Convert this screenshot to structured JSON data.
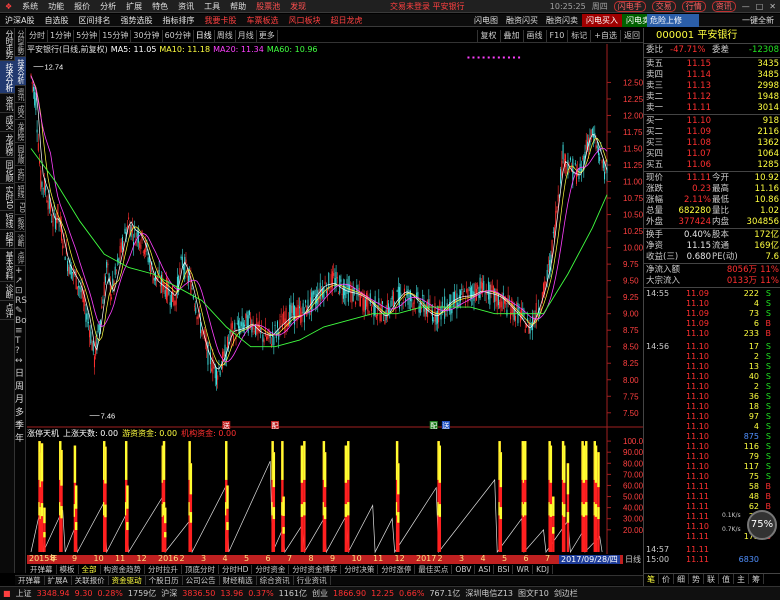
{
  "menu": {
    "items": [
      "系统",
      "功能",
      "报价",
      "分析",
      "扩展",
      "特色",
      "资讯",
      "工具",
      "帮助"
    ],
    "highlight": "股票池",
    "message": "交易未登录  平安银行",
    "clock": "10:25:25",
    "weekday": "周四",
    "buttons": [
      "闪电手",
      "交易",
      "行情",
      "资讯"
    ]
  },
  "funcbar": {
    "left": [
      "沪深A股",
      "自选股",
      "区间排名",
      "强势选股",
      "指标排序"
    ],
    "left_red": [
      "我要卡股",
      "车票板选",
      "风口板块",
      "超日龙虎"
    ],
    "right": [
      "闪电图",
      "融资闪买",
      "融资闪卖",
      "闪电买入",
      "闪电卖出"
    ],
    "ad": "危险上修",
    "help": "一键全新"
  },
  "leftbar": {
    "tabs": [
      "分时走势",
      "技术分析",
      "资讯",
      "成交",
      "龙虎榜",
      "同花顺",
      "实时10",
      "短线",
      "超市",
      "基本资料",
      "诊断",
      "点评"
    ],
    "active_index": 1,
    "tools": [
      "+",
      "↗",
      "⊡",
      "RSI",
      "✎",
      "Bot",
      "≡",
      "T",
      "?",
      "↔"
    ],
    "vertical_labels": [
      "日",
      "周",
      "月",
      "多",
      "季",
      "年"
    ]
  },
  "leftbar2": {
    "tabs": [
      "分时走势",
      "技术分析",
      "资讯",
      "成交",
      "龙虎榜",
      "同花顺",
      "实时",
      "短线",
      "F10",
      "板块",
      "诊断",
      "点评"
    ]
  },
  "period_bar": {
    "items": [
      "分时",
      "1分钟",
      "5分钟",
      "15分钟",
      "30分钟",
      "60分钟",
      "日线",
      "周线",
      "月线",
      "更多"
    ],
    "active": "日线",
    "right": [
      "复权",
      "叠加",
      "画线",
      "F10",
      "标记",
      "+自选",
      "返回"
    ]
  },
  "chart": {
    "title": "平安银行(日线,前复权)",
    "ma": [
      {
        "label": "MA5: 11.05",
        "color": "#ffffff"
      },
      {
        "label": "MA10: 11.18",
        "color": "#ffff40"
      },
      {
        "label": "MA20: 11.34",
        "color": "#ff40ff"
      },
      {
        "label": "MA60: 10.96",
        "color": "#40ff40"
      }
    ],
    "high_label": "12.74",
    "low_label": "7.46",
    "yticks": [
      "12.50",
      "12.25",
      "12.00",
      "11.75",
      "11.50",
      "11.25",
      "11.00",
      "10.75",
      "10.50",
      "10.25",
      "10.00",
      "9.75",
      "9.50",
      "9.25",
      "9.00",
      "8.75",
      "8.50",
      "8.25",
      "8.00",
      "7.75",
      "7.50"
    ],
    "ind_yticks": [
      "100.00",
      "90.00",
      "80.00",
      "70.00",
      "60.00",
      "50.00",
      "40.00",
      "30.00",
      "20.00"
    ],
    "indicator": [
      {
        "label": "涨停天机",
        "color": "#ffffff"
      },
      {
        "label": "上涨天数: 0.00",
        "color": "#ffffff"
      },
      {
        "label": "游资资金: 0.00",
        "color": "#ffff40"
      },
      {
        "label": "机构资金: 0.00",
        "color": "#ff3030"
      }
    ],
    "event_markers": [
      "送",
      "配",
      "配",
      "送"
    ],
    "candle_colors": {
      "up": "#ff3030",
      "down": "#40e0e0",
      "ma5": "#ffffff",
      "ma10": "#ffff40",
      "ma20": "#ff40ff",
      "ma60": "#40ff40"
    }
  },
  "chart_data": {
    "type": "candlestick",
    "title": "平安银行(日线,前复权)",
    "ylim": [
      7.3,
      12.9
    ],
    "ind_ylim": [
      0,
      110
    ],
    "x_labels": [
      "2015年",
      "8",
      "9",
      "10",
      "11",
      "12",
      "2016",
      "2",
      "3",
      "4",
      "5",
      "6",
      "7",
      "8",
      "9",
      "10",
      "11",
      "12",
      "2017",
      "2",
      "3",
      "4",
      "5",
      "6",
      "7"
    ],
    "current_date": "2017/09/28/四",
    "price_path": [
      [
        0,
        12.6
      ],
      [
        4,
        12.2
      ],
      [
        8,
        11.0
      ],
      [
        12,
        10.9
      ],
      [
        18,
        10.4
      ],
      [
        22,
        10.5
      ],
      [
        30,
        9.8
      ],
      [
        40,
        9.4
      ],
      [
        48,
        8.8
      ],
      [
        52,
        8.3
      ],
      [
        58,
        9.1
      ],
      [
        62,
        9.7
      ],
      [
        66,
        9.3
      ],
      [
        72,
        9.8
      ],
      [
        80,
        10.4
      ],
      [
        84,
        10.2
      ],
      [
        88,
        10.2
      ],
      [
        94,
        10.0
      ],
      [
        100,
        9.6
      ],
      [
        110,
        9.4
      ],
      [
        118,
        9.2
      ],
      [
        124,
        9.8
      ],
      [
        132,
        9.4
      ],
      [
        138,
        8.9
      ],
      [
        145,
        8.4
      ],
      [
        152,
        8.1
      ],
      [
        158,
        8.3
      ],
      [
        164,
        8.7
      ],
      [
        172,
        8.8
      ],
      [
        180,
        8.9
      ],
      [
        188,
        8.7
      ],
      [
        196,
        8.6
      ],
      [
        204,
        8.8
      ],
      [
        212,
        9.0
      ],
      [
        222,
        9.0
      ],
      [
        232,
        9.2
      ],
      [
        240,
        9.4
      ],
      [
        248,
        9.5
      ],
      [
        256,
        9.4
      ],
      [
        264,
        9.3
      ],
      [
        272,
        9.2
      ],
      [
        282,
        9.1
      ],
      [
        290,
        9.0
      ],
      [
        298,
        9.2
      ],
      [
        306,
        9.3
      ],
      [
        314,
        9.2
      ],
      [
        322,
        9.1
      ],
      [
        332,
        9.0
      ],
      [
        340,
        9.1
      ],
      [
        350,
        9.2
      ],
      [
        360,
        9.3
      ],
      [
        368,
        9.4
      ],
      [
        376,
        9.3
      ],
      [
        384,
        9.2
      ],
      [
        392,
        9.1
      ],
      [
        400,
        9.0
      ],
      [
        408,
        8.8
      ],
      [
        414,
        9.0
      ],
      [
        420,
        9.3
      ],
      [
        426,
        9.8
      ],
      [
        432,
        10.8
      ],
      [
        436,
        11.4
      ],
      [
        442,
        11.2
      ],
      [
        450,
        11.1
      ],
      [
        456,
        11.6
      ],
      [
        460,
        11.7
      ],
      [
        466,
        11.4
      ],
      [
        472,
        11.1
      ]
    ],
    "ma60_path": [
      [
        0,
        11.5
      ],
      [
        20,
        11.0
      ],
      [
        40,
        10.4
      ],
      [
        60,
        9.9
      ],
      [
        80,
        9.7
      ],
      [
        100,
        9.6
      ],
      [
        120,
        9.4
      ],
      [
        140,
        9.2
      ],
      [
        160,
        8.8
      ],
      [
        180,
        8.5
      ],
      [
        200,
        8.5
      ],
      [
        220,
        8.6
      ],
      [
        240,
        8.8
      ],
      [
        260,
        8.9
      ],
      [
        280,
        9.0
      ],
      [
        300,
        9.0
      ],
      [
        320,
        9.1
      ],
      [
        340,
        9.1
      ],
      [
        360,
        9.1
      ],
      [
        380,
        9.0
      ],
      [
        400,
        9.0
      ],
      [
        420,
        9.0
      ],
      [
        440,
        9.6
      ],
      [
        460,
        10.3
      ],
      [
        472,
        10.8
      ]
    ],
    "sawtooth": [
      [
        0,
        0
      ],
      [
        8,
        40
      ],
      [
        10,
        0
      ],
      [
        26,
        38
      ],
      [
        28,
        0
      ],
      [
        36,
        22
      ],
      [
        38,
        0
      ],
      [
        60,
        45
      ],
      [
        62,
        0
      ],
      [
        78,
        34
      ],
      [
        80,
        0
      ],
      [
        108,
        50
      ],
      [
        110,
        0
      ],
      [
        130,
        28
      ],
      [
        132,
        0
      ],
      [
        160,
        60
      ],
      [
        162,
        0
      ],
      [
        196,
        82
      ],
      [
        198,
        0
      ],
      [
        206,
        20
      ],
      [
        208,
        0
      ],
      [
        222,
        24
      ],
      [
        224,
        0
      ],
      [
        240,
        30
      ],
      [
        242,
        0
      ],
      [
        258,
        32
      ],
      [
        260,
        0
      ],
      [
        280,
        42
      ],
      [
        282,
        0
      ],
      [
        296,
        30
      ],
      [
        298,
        0
      ],
      [
        332,
        58
      ],
      [
        334,
        0
      ],
      [
        380,
        65
      ],
      [
        382,
        0
      ],
      [
        402,
        30
      ],
      [
        404,
        0
      ],
      [
        420,
        20
      ],
      [
        422,
        0
      ],
      [
        440,
        28
      ],
      [
        442,
        0
      ],
      [
        452,
        18
      ],
      [
        454,
        0
      ],
      [
        466,
        14
      ],
      [
        468,
        0
      ]
    ],
    "spike_x": [
      7,
      8,
      9,
      11,
      24,
      25,
      36,
      37,
      60,
      61,
      78,
      79,
      108,
      109,
      110,
      130,
      131,
      160,
      161,
      198,
      199,
      206,
      207,
      222,
      224,
      240,
      241,
      258,
      260,
      300,
      301,
      334,
      335,
      384,
      385,
      403,
      404,
      405,
      425,
      426,
      428,
      436,
      437,
      440,
      452,
      453,
      455,
      462,
      463,
      465
    ],
    "spike_h": [
      100,
      90,
      98,
      40,
      100,
      92,
      96,
      60,
      100,
      95,
      100,
      60,
      96,
      100,
      40,
      100,
      80,
      100,
      60,
      100,
      90,
      100,
      50,
      96,
      100,
      100,
      90,
      96,
      100,
      100,
      80,
      100,
      96,
      100,
      90,
      100,
      96,
      100,
      100,
      96,
      50,
      100,
      96,
      80,
      100,
      96,
      100,
      100,
      96,
      90
    ]
  },
  "datebar": {
    "labels": [
      "2015年",
      "8",
      "9",
      "10",
      "11",
      "12",
      "2016",
      "2",
      "3",
      "4",
      "5",
      "6",
      "7",
      "8",
      "9",
      "10",
      "11",
      "12",
      "2017",
      "2",
      "3",
      "4",
      "5",
      "6",
      "7"
    ],
    "current": "2017/09/28/四",
    "right": "日线"
  },
  "tabs1": {
    "items": [
      "开弹幕",
      "模板",
      "全部",
      "构资金趋势",
      "分时拉升",
      "顶底分时",
      "分时HD",
      "分时资金",
      "分时资金博弈",
      "分时决策",
      "分时涨停",
      "最佳买点",
      "OBV",
      "ASI",
      "BSI",
      "WR",
      "KDJ"
    ],
    "active": "全部"
  },
  "tabs2": {
    "items": [
      "开弹幕",
      "扩展A",
      "关联报价",
      "资金驱动",
      "个股日历",
      "公司公告",
      "财经精选",
      "综合资讯",
      "行业资讯"
    ],
    "active": "资金驱动"
  },
  "status": {
    "items": [
      {
        "label": "上证",
        "color": "#ccc"
      },
      {
        "label": "3348.94",
        "color": "#ff3030"
      },
      {
        "label": "9.30",
        "color": "#ff3030"
      },
      {
        "label": "0.28%",
        "color": "#ff3030"
      },
      {
        "label": "1759亿",
        "color": "#ccc"
      },
      {
        "label": "沪深",
        "color": "#ccc"
      },
      {
        "label": "3836.50",
        "color": "#ff3030"
      },
      {
        "label": "13.96",
        "color": "#ff3030"
      },
      {
        "label": "0.37%",
        "color": "#ff3030"
      },
      {
        "label": "1161亿",
        "color": "#ccc"
      },
      {
        "label": "创业",
        "color": "#ccc"
      },
      {
        "label": "1866.90",
        "color": "#ff3030"
      },
      {
        "label": "12.25",
        "color": "#ff3030"
      },
      {
        "label": "0.66%",
        "color": "#ff3030"
      },
      {
        "label": "767.1亿",
        "color": "#ccc"
      },
      {
        "label": "深圳电信Z13",
        "color": "#ccc"
      },
      {
        "label": "图文F10",
        "color": "#ccc"
      },
      {
        "label": "剑边栏",
        "color": "#ccc"
      }
    ]
  },
  "panel": {
    "code_name": "000001 平安银行",
    "weibi": {
      "label": "委比",
      "value": "-47.71%",
      "label2": "委差",
      "value2": "-12308"
    },
    "asks": [
      {
        "label": "卖五",
        "price": "11.15",
        "vol": "3435"
      },
      {
        "label": "卖四",
        "price": "11.14",
        "vol": "3485"
      },
      {
        "label": "卖三",
        "price": "11.13",
        "vol": "2998"
      },
      {
        "label": "卖二",
        "price": "11.12",
        "vol": "1948"
      },
      {
        "label": "卖一",
        "price": "11.11",
        "vol": "3014"
      }
    ],
    "bids": [
      {
        "label": "买一",
        "price": "11.10",
        "vol": "918"
      },
      {
        "label": "买二",
        "price": "11.09",
        "vol": "2116"
      },
      {
        "label": "买三",
        "price": "11.08",
        "vol": "1362"
      },
      {
        "label": "买四",
        "price": "11.07",
        "vol": "1064"
      },
      {
        "label": "买五",
        "price": "11.06",
        "vol": "1285"
      }
    ],
    "stats": [
      {
        "l1": "现价",
        "v1": "11.11",
        "c1": "red",
        "l2": "今开",
        "v2": "10.92",
        "c2": "green"
      },
      {
        "l1": "涨跌",
        "v1": "0.23",
        "c1": "red",
        "l2": "最高",
        "v2": "11.16",
        "c2": "red"
      },
      {
        "l1": "涨幅",
        "v1": "2.11%",
        "c1": "red",
        "l2": "最低",
        "v2": "10.86",
        "c2": "green"
      },
      {
        "l1": "总量",
        "v1": "682280",
        "c1": "yellow",
        "l2": "量比",
        "v2": "1.02",
        "c2": "red"
      },
      {
        "l1": "外盘",
        "v1": "377424",
        "c1": "red",
        "l2": "内盘",
        "v2": "304856",
        "c2": "green"
      }
    ],
    "stats2": [
      {
        "l1": "换手",
        "v1": "0.40%",
        "l2": "股本",
        "v2": "172亿"
      },
      {
        "l1": "净资",
        "v1": "11.15",
        "l2": "流通",
        "v2": "169亿"
      },
      {
        "l1": "收益(三)",
        "v1": "0.680",
        "l2": "PE(动)",
        "v2": "7.6"
      }
    ],
    "flows": [
      {
        "label": "净流入额",
        "value": "8056万",
        "pct": "11%"
      },
      {
        "label": "大宗流入",
        "value": "0133万",
        "pct": "11%"
      }
    ],
    "ticks": [
      {
        "t": "14:55",
        "p": "11.09",
        "pc": "red",
        "v": "222",
        "vc": "yellow",
        "f": "S",
        "fc": "green"
      },
      {
        "t": "",
        "p": "11.10",
        "pc": "red",
        "v": "4",
        "vc": "yellow",
        "f": "S",
        "fc": "green"
      },
      {
        "t": "",
        "p": "11.09",
        "pc": "red",
        "v": "73",
        "vc": "yellow",
        "f": "S",
        "fc": "green"
      },
      {
        "t": "",
        "p": "11.09",
        "pc": "red",
        "v": "6",
        "vc": "yellow",
        "f": "B",
        "fc": "red"
      },
      {
        "t": "",
        "p": "11.10",
        "pc": "red",
        "v": "233",
        "vc": "yellow",
        "f": "B",
        "fc": "red"
      },
      {
        "t": "14:56",
        "p": "11.10",
        "pc": "red",
        "v": "17",
        "vc": "yellow",
        "f": "S",
        "fc": "green"
      },
      {
        "t": "",
        "p": "11.10",
        "pc": "red",
        "v": "2",
        "vc": "yellow",
        "f": "S",
        "fc": "green"
      },
      {
        "t": "",
        "p": "11.10",
        "pc": "red",
        "v": "13",
        "vc": "yellow",
        "f": "S",
        "fc": "green"
      },
      {
        "t": "",
        "p": "11.10",
        "pc": "red",
        "v": "40",
        "vc": "yellow",
        "f": "S",
        "fc": "green"
      },
      {
        "t": "",
        "p": "11.10",
        "pc": "red",
        "v": "2",
        "vc": "yellow",
        "f": "S",
        "fc": "green"
      },
      {
        "t": "",
        "p": "11.10",
        "pc": "red",
        "v": "36",
        "vc": "yellow",
        "f": "S",
        "fc": "green"
      },
      {
        "t": "",
        "p": "11.10",
        "pc": "red",
        "v": "18",
        "vc": "yellow",
        "f": "S",
        "fc": "green"
      },
      {
        "t": "",
        "p": "11.10",
        "pc": "red",
        "v": "97",
        "vc": "yellow",
        "f": "S",
        "fc": "green"
      },
      {
        "t": "",
        "p": "11.10",
        "pc": "red",
        "v": "4",
        "vc": "yellow",
        "f": "S",
        "fc": "green"
      },
      {
        "t": "",
        "p": "11.10",
        "pc": "red",
        "v": "875",
        "vc": "blue",
        "f": "S",
        "fc": "green"
      },
      {
        "t": "",
        "p": "11.10",
        "pc": "red",
        "v": "116",
        "vc": "yellow",
        "f": "S",
        "fc": "green"
      },
      {
        "t": "",
        "p": "11.10",
        "pc": "red",
        "v": "79",
        "vc": "yellow",
        "f": "S",
        "fc": "green"
      },
      {
        "t": "",
        "p": "11.10",
        "pc": "red",
        "v": "117",
        "vc": "yellow",
        "f": "S",
        "fc": "green"
      },
      {
        "t": "",
        "p": "11.10",
        "pc": "red",
        "v": "75",
        "vc": "yellow",
        "f": "S",
        "fc": "green"
      },
      {
        "t": "",
        "p": "11.11",
        "pc": "red",
        "v": "58",
        "vc": "yellow",
        "f": "B",
        "fc": "red"
      },
      {
        "t": "",
        "p": "11.11",
        "pc": "red",
        "v": "48",
        "vc": "yellow",
        "f": "B",
        "fc": "red"
      },
      {
        "t": "",
        "p": "11.11",
        "pc": "red",
        "v": "62",
        "vc": "yellow",
        "f": "B",
        "fc": "red"
      },
      {
        "t": "",
        "p": "11.11",
        "pc": "red",
        "v": "21",
        "vc": "yellow",
        "f": "B",
        "fc": "red"
      },
      {
        "t": "",
        "p": "11.10",
        "pc": "red",
        "v": "3",
        "vc": "yellow",
        "f": "B",
        "fc": "red"
      },
      {
        "t": "",
        "p": "11.11",
        "pc": "red",
        "v": "173",
        "vc": "yellow",
        "f": "B",
        "fc": "red"
      },
      {
        "t": "14:57",
        "p": "11.11",
        "pc": "red",
        "v": "",
        "vc": "yellow",
        "f": "",
        "fc": "red"
      },
      {
        "t": "15:00",
        "p": "11.11",
        "pc": "red",
        "v": "6830",
        "vc": "blue",
        "f": "",
        "fc": "red"
      }
    ],
    "tabs": [
      "笔",
      "价",
      "细",
      "势",
      "联",
      "值",
      "主",
      "筹"
    ],
    "active_tab": "笔"
  },
  "gauge": {
    "value": "75%",
    "mini1": "0.1K/s",
    "mini2": "0.7K/s"
  }
}
